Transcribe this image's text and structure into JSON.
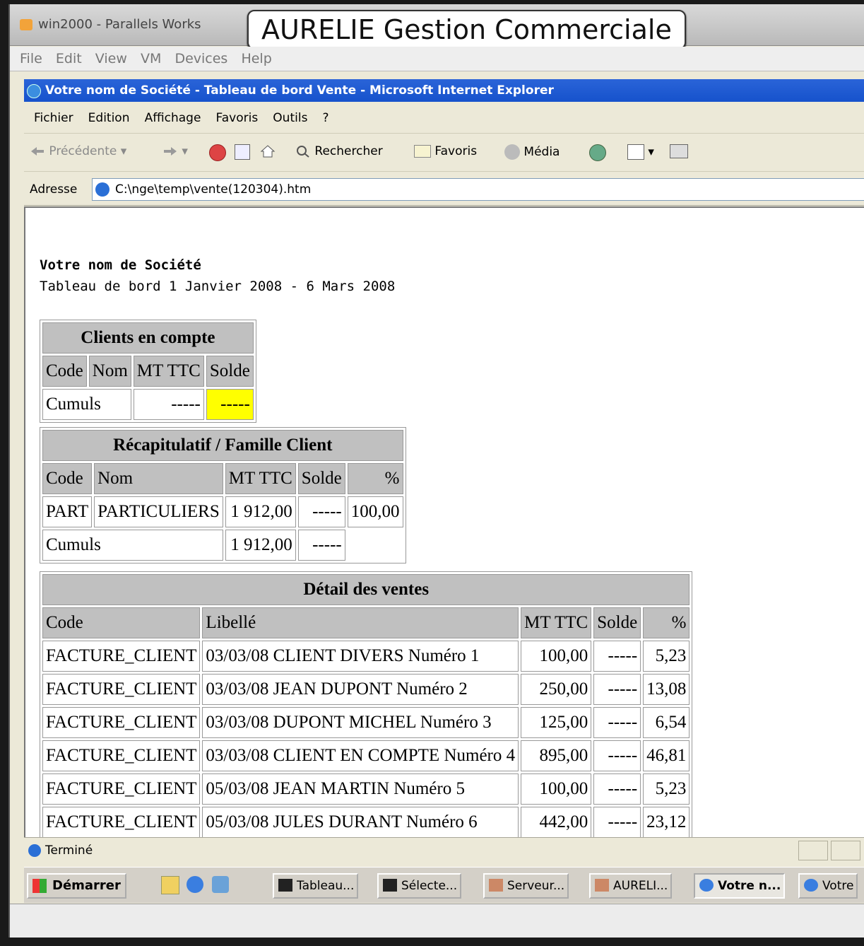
{
  "overlay_title": "AURELIE Gestion Commerciale",
  "vm": {
    "title": "win2000 - Parallels Works",
    "menu": [
      "File",
      "Edit",
      "View",
      "VM",
      "Devices",
      "Help"
    ]
  },
  "ie": {
    "title": "Votre nom de Société - Tableau de bord Vente - Microsoft Internet Explorer",
    "menu": [
      "Fichier",
      "Edition",
      "Affichage",
      "Favoris",
      "Outils",
      "?"
    ],
    "toolbar": {
      "back": "Précédente",
      "search": "Rechercher",
      "favorites": "Favoris",
      "media": "Média"
    },
    "address_label": "Adresse",
    "address_value": "C:\\nge\\temp\\vente(120304).htm"
  },
  "report": {
    "company": "Votre nom de Société",
    "subtitle": "Tableau de bord 1 Janvier 2008 - 6 Mars 2008",
    "clients": {
      "title": "Clients en compte",
      "columns": [
        "Code",
        "Nom",
        "MT TTC",
        "Solde"
      ],
      "cumuls_label": "Cumuls",
      "cumuls_mt": "-----",
      "cumuls_solde": "-----"
    },
    "familles": {
      "title": "Récapitulatif / Famille Client",
      "columns": [
        "Code",
        "Nom",
        "MT TTC",
        "Solde",
        "%"
      ],
      "rows": [
        {
          "code": "PART",
          "nom": "PARTICULIERS",
          "mt": "1 912,00",
          "solde": "-----",
          "pct": "100,00"
        }
      ],
      "cumuls_label": "Cumuls",
      "cumuls_mt": "1 912,00",
      "cumuls_solde": "-----"
    },
    "ventes": {
      "title": "Détail des ventes",
      "columns": [
        "Code",
        "Libellé",
        "MT TTC",
        "Solde",
        "%"
      ],
      "rows": [
        {
          "code": "FACTURE_CLIENT",
          "libelle": "03/03/08 CLIENT DIVERS Numéro 1",
          "mt": "100,00",
          "solde": "-----",
          "pct": "5,23"
        },
        {
          "code": "FACTURE_CLIENT",
          "libelle": "03/03/08 JEAN DUPONT Numéro 2",
          "mt": "250,00",
          "solde": "-----",
          "pct": "13,08"
        },
        {
          "code": "FACTURE_CLIENT",
          "libelle": "03/03/08 DUPONT MICHEL Numéro 3",
          "mt": "125,00",
          "solde": "-----",
          "pct": "6,54"
        },
        {
          "code": "FACTURE_CLIENT",
          "libelle": "03/03/08 CLIENT EN COMPTE Numéro 4",
          "mt": "895,00",
          "solde": "-----",
          "pct": "46,81"
        },
        {
          "code": "FACTURE_CLIENT",
          "libelle": "05/03/08 JEAN MARTIN Numéro 5",
          "mt": "100,00",
          "solde": "-----",
          "pct": "5,23"
        },
        {
          "code": "FACTURE_CLIENT",
          "libelle": "05/03/08 JULES DURANT Numéro 6",
          "mt": "442,00",
          "solde": "-----",
          "pct": "23,12"
        }
      ]
    }
  },
  "status": "Terminé",
  "taskbar": {
    "start": "Démarrer",
    "buttons": [
      "Tableau...",
      "Sélecte...",
      "Serveur...",
      "AURELI...",
      "Votre n...",
      "Votre"
    ]
  },
  "colors": {
    "ie_title_blue": "#1652cc",
    "header_gray": "#c0c0c0",
    "highlight_yellow": "#ffff00"
  }
}
